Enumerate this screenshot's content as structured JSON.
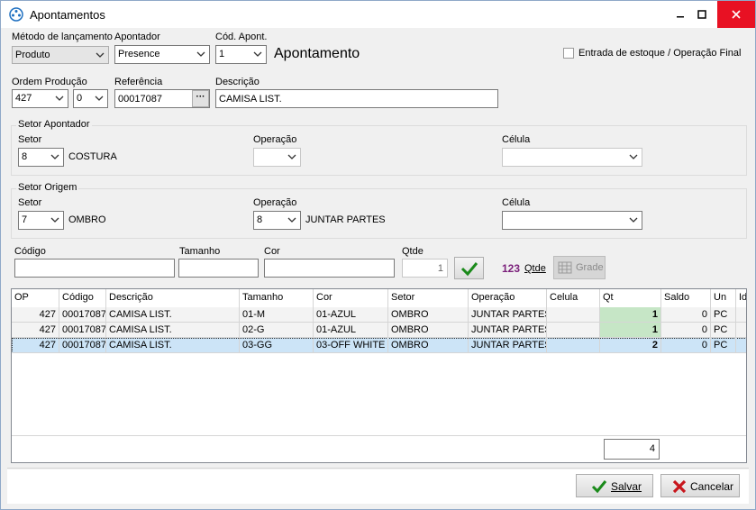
{
  "window": {
    "title": "Apontamentos",
    "minimize": "−",
    "maximize": "☐",
    "close": "✕"
  },
  "header": {
    "metodo_label": "Método de lançamento",
    "metodo_value": "Produto",
    "apontador_label": "Apontador",
    "apontador_value": "Presence",
    "cod_label": "Cód. Apont.",
    "cod_value": "1",
    "apontamento_title": "Apontamento",
    "entrada_label": "Entrada de estoque / Operação Final"
  },
  "ordem": {
    "ordem_label": "Ordem Produção",
    "ordem_value": "427",
    "ordem_sub": "0",
    "referencia_label": "Referência",
    "referencia_value": "00017087",
    "browse_label": "···",
    "descricao_label": "Descrição",
    "descricao_value": "CAMISA LIST."
  },
  "setor_apontador": {
    "title": "Setor Apontador",
    "setor_label": "Setor",
    "setor_value": "8",
    "setor_name": "COSTURA",
    "operacao_label": "Operação",
    "operacao_value": "",
    "celula_label": "Célula",
    "celula_value": ""
  },
  "setor_origem": {
    "title": "Setor Origem",
    "setor_label": "Setor",
    "setor_value": "7",
    "setor_name": "OMBRO",
    "operacao_label": "Operação",
    "operacao_value": "8",
    "operacao_name": "JUNTAR PARTES",
    "celula_label": "Célula",
    "celula_value": ""
  },
  "entry": {
    "codigo_label": "Código",
    "tamanho_label": "Tamanho",
    "cor_label": "Cor",
    "qtde_label": "Qtde",
    "qtde_value": "1",
    "count_value": "123",
    "count_label": "Qtde",
    "grade_label": "Grade"
  },
  "grid": {
    "columns": [
      "OP",
      "Código",
      "Descrição",
      "Tamanho",
      "Cor",
      "Setor",
      "Operação",
      "Celula",
      "Qt",
      "Saldo",
      "Un",
      "Id"
    ],
    "rows": [
      [
        "427",
        "00017087",
        "CAMISA LIST.",
        "01-M",
        "01-AZUL",
        "OMBRO",
        "JUNTAR PARTES",
        "",
        "1",
        "0",
        "PC",
        ""
      ],
      [
        "427",
        "00017087",
        "CAMISA LIST.",
        "02-G",
        "01-AZUL",
        "OMBRO",
        "JUNTAR PARTES",
        "",
        "1",
        "0",
        "PC",
        ""
      ],
      [
        "427",
        "00017087",
        "CAMISA LIST.",
        "03-GG",
        "03-OFF WHITE",
        "OMBRO",
        "JUNTAR PARTES",
        "",
        "2",
        "0",
        "PC",
        ""
      ]
    ],
    "total": "4"
  },
  "footer": {
    "salvar_label": "Salvar",
    "cancelar_label": "Cancelar"
  },
  "colors": {
    "qt_highlight": "#c6e6c6",
    "selected_row": "#cce4f7",
    "count_color": "#7a1f7a",
    "close_red": "#e81123"
  }
}
